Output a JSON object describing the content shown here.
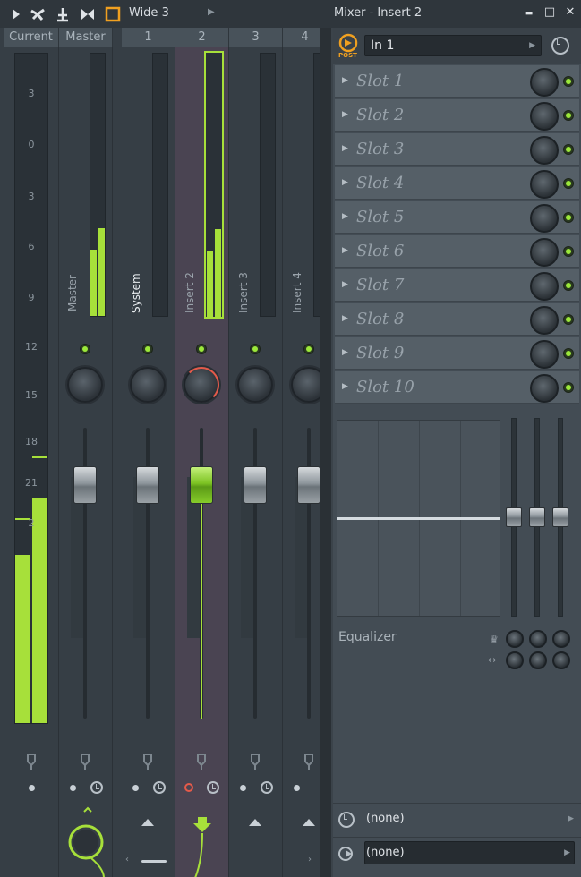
{
  "titlebar": {
    "layout_label": "Wide 3",
    "window_title": "Mixer - Insert 2",
    "minimize": "▬",
    "maximize": "□",
    "close": "✕"
  },
  "columns": {
    "current": "Current",
    "master": "Master",
    "n1": "1",
    "n2": "2",
    "n3": "3",
    "n4": "4"
  },
  "scale": [
    "3",
    "0",
    "3",
    "6",
    "9",
    "12",
    "15",
    "18",
    "21",
    "2"
  ],
  "tracks": [
    {
      "name": "Master"
    },
    {
      "name": "System"
    },
    {
      "name": "Insert 2"
    },
    {
      "name": "Insert 3"
    },
    {
      "name": "Insert 4"
    }
  ],
  "insert": {
    "post_label": "POST",
    "input": "In 1",
    "slots": [
      "Slot 1",
      "Slot 2",
      "Slot 3",
      "Slot 4",
      "Slot 5",
      "Slot 6",
      "Slot 7",
      "Slot 8",
      "Slot 9",
      "Slot 10"
    ],
    "eq_label": "Equalizer",
    "time_label": "(none)",
    "output_label": "(none)"
  },
  "colors": {
    "accent_green": "#a7e03a",
    "record_red": "#e45a4a",
    "post_orange": "#f0a020"
  }
}
